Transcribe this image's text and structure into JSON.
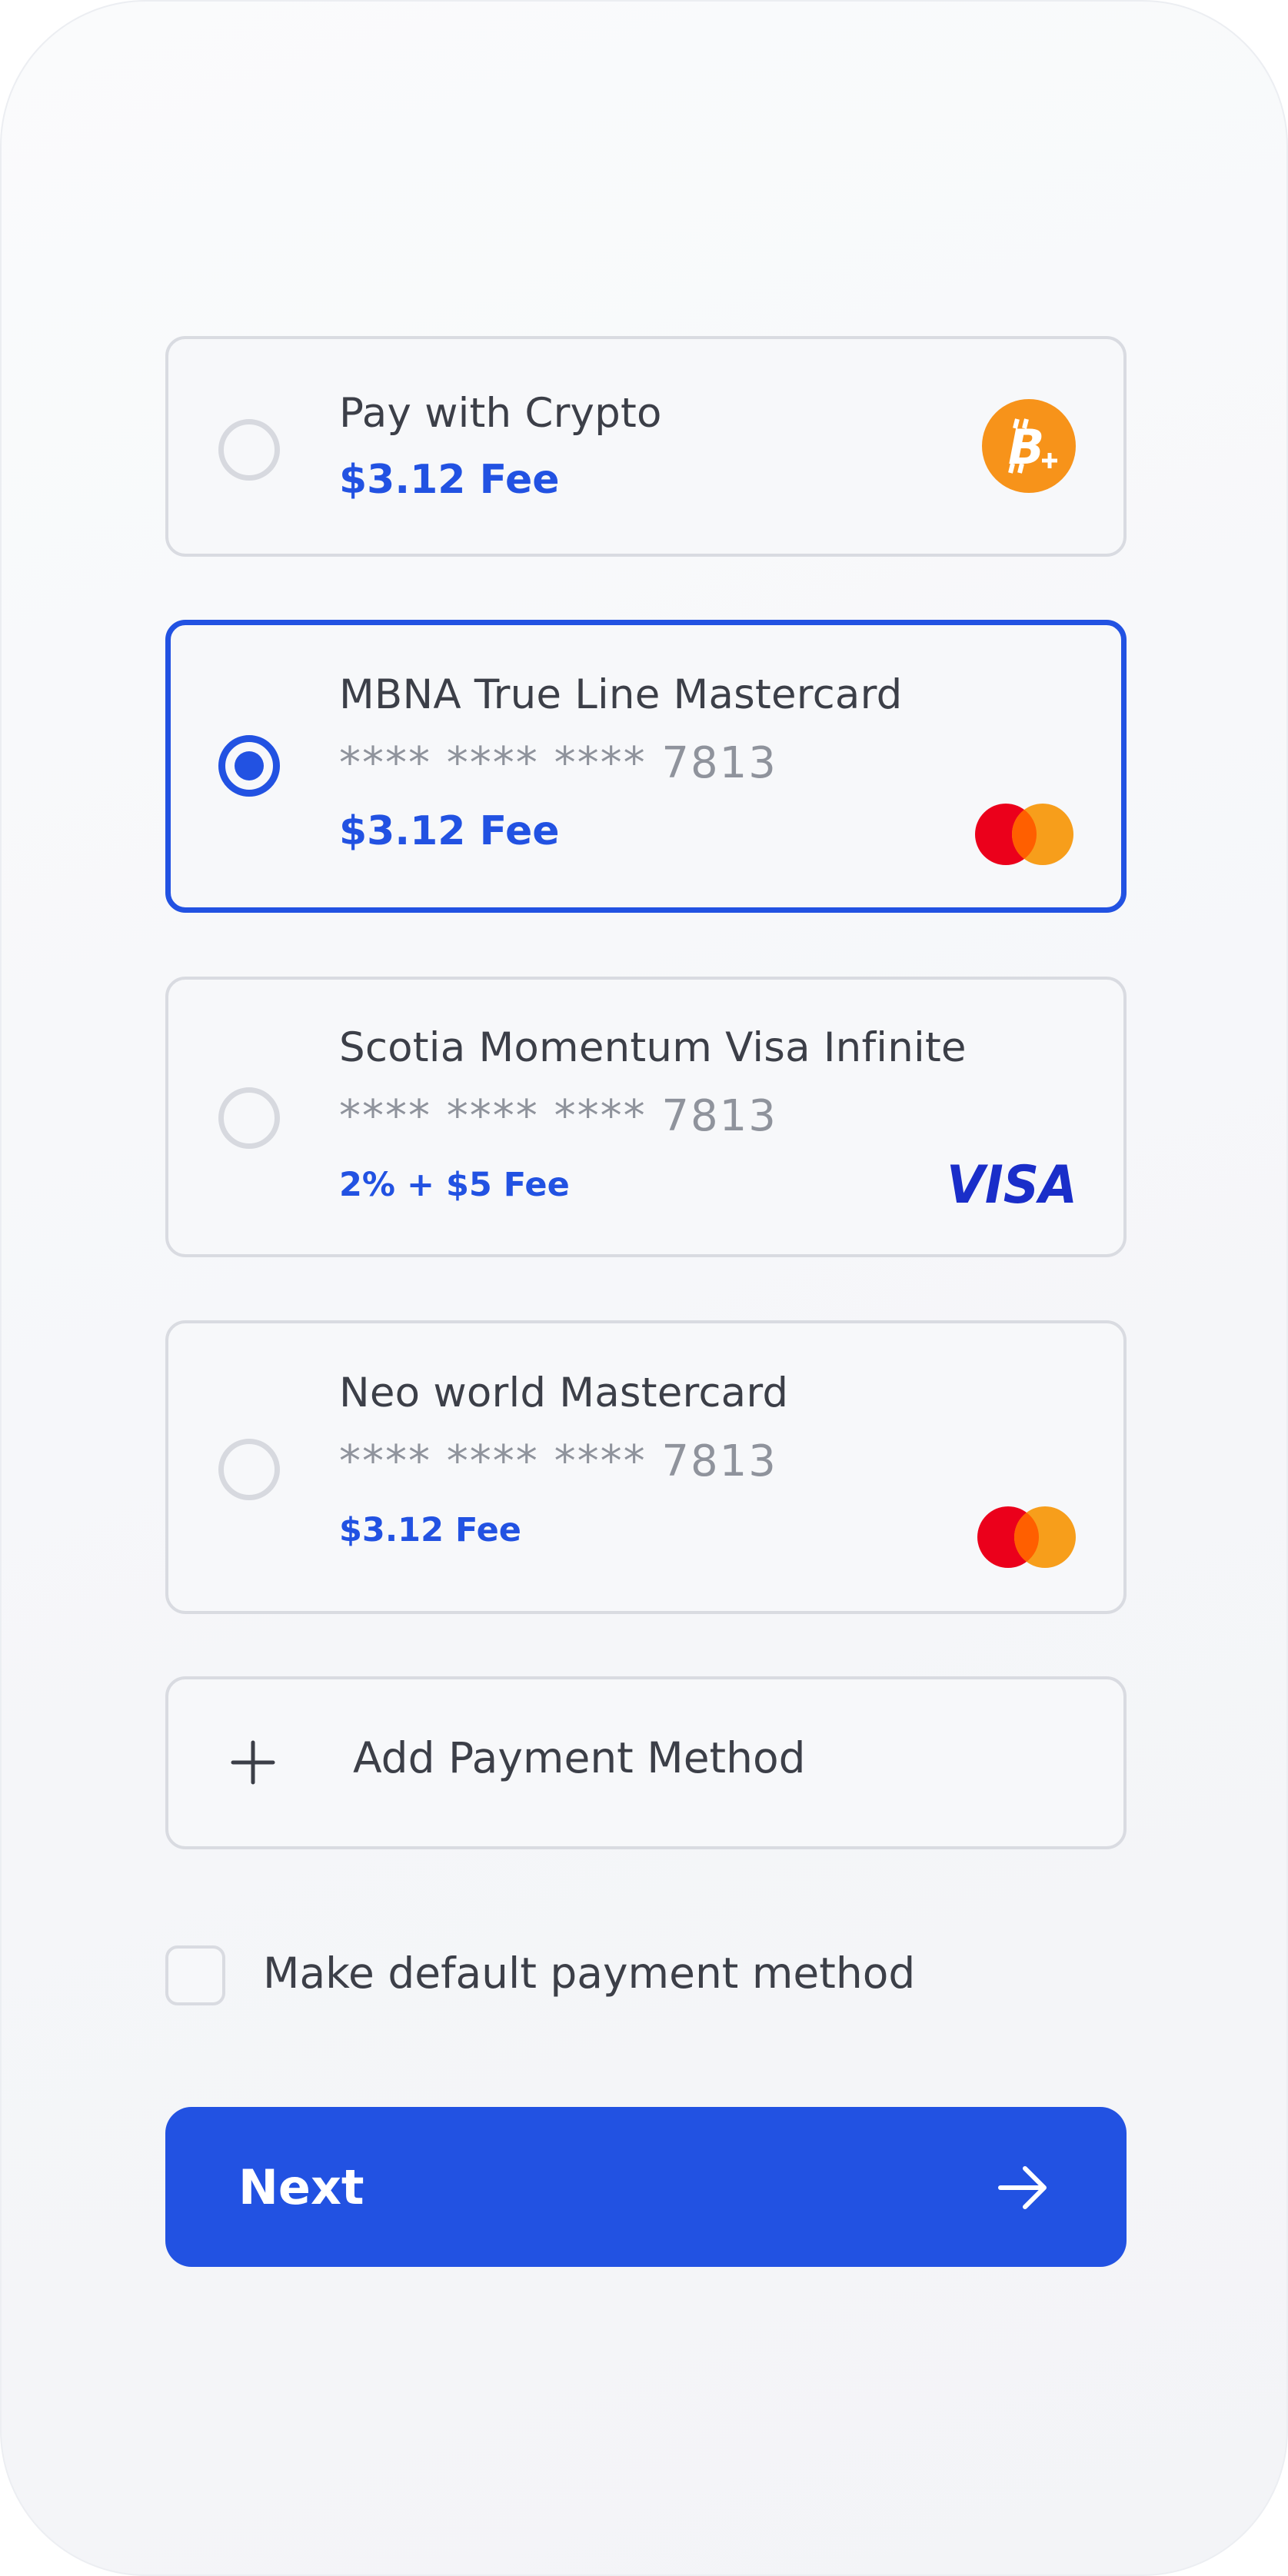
{
  "payment_methods": [
    {
      "title": "Pay with Crypto",
      "fee": "$3.12 Fee",
      "selected": false,
      "icon": "bitcoin-plus-icon"
    },
    {
      "title": "MBNA True Line Mastercard",
      "masked_number": "**** **** **** 7813",
      "fee": "$3.12 Fee",
      "selected": true,
      "icon": "mastercard-logo"
    },
    {
      "title": "Scotia Momentum Visa Infinite",
      "masked_number": "**** **** **** 7813",
      "fee": "2% + $5 Fee",
      "selected": false,
      "icon": "visa-logo"
    },
    {
      "title": "Neo world Mastercard",
      "masked_number": "**** **** **** 7813",
      "fee": "$3.12 Fee",
      "selected": false,
      "icon": "mastercard-logo"
    }
  ],
  "add_method": {
    "label": "Add Payment Method",
    "icon": "plus-icon"
  },
  "default_checkbox": {
    "label": "Make default payment method",
    "checked": false
  },
  "next_button": {
    "label": "Next",
    "icon": "arrow-right-icon"
  },
  "colors": {
    "accent": "#2252e2",
    "bitcoin": "#f7931a",
    "mastercard_red": "#eb001b",
    "mastercard_orange": "#f79e1b",
    "visa_blue": "#1a2ec9"
  }
}
